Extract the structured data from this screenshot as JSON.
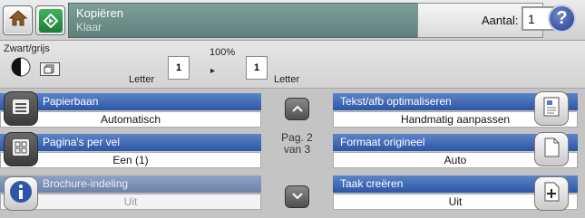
{
  "header": {
    "title": "Kopiëren",
    "status": "Klaar",
    "copies_label": "Aantal:",
    "copies_value": "1",
    "help_symbol": "?"
  },
  "icons": {
    "home": "home-icon",
    "copy": "copy-start-icon",
    "help": "help-icon"
  },
  "options_bar": {
    "color_mode": "Zwart/grijs",
    "zoom": "100%",
    "original_size": "Letter",
    "original_count": "1",
    "arrow": "▸",
    "copy_count": "1",
    "destination_size": "Letter"
  },
  "settings": {
    "left": [
      {
        "label": "Papierbaan",
        "value": "Automatisch",
        "enabled": true
      },
      {
        "label": "Pagina's per vel",
        "value": "Een (1)",
        "enabled": true
      },
      {
        "label": "Brochure-indeling",
        "value": "Uit",
        "enabled": false
      }
    ],
    "right": [
      {
        "label": "Tekst/afb optimaliseren",
        "value": "Handmatig aanpassen",
        "enabled": true
      },
      {
        "label": "Formaat origineel",
        "value": "Auto",
        "enabled": true
      },
      {
        "label": "Taak creëren",
        "value": "Uit",
        "enabled": true
      }
    ],
    "pagination": {
      "line1": "Pag. 2",
      "line2": "van 3"
    }
  },
  "colors": {
    "accent_blue": "#2c56a6",
    "title_panel": "#6f8f8a",
    "start_green": "#2a9a46"
  }
}
